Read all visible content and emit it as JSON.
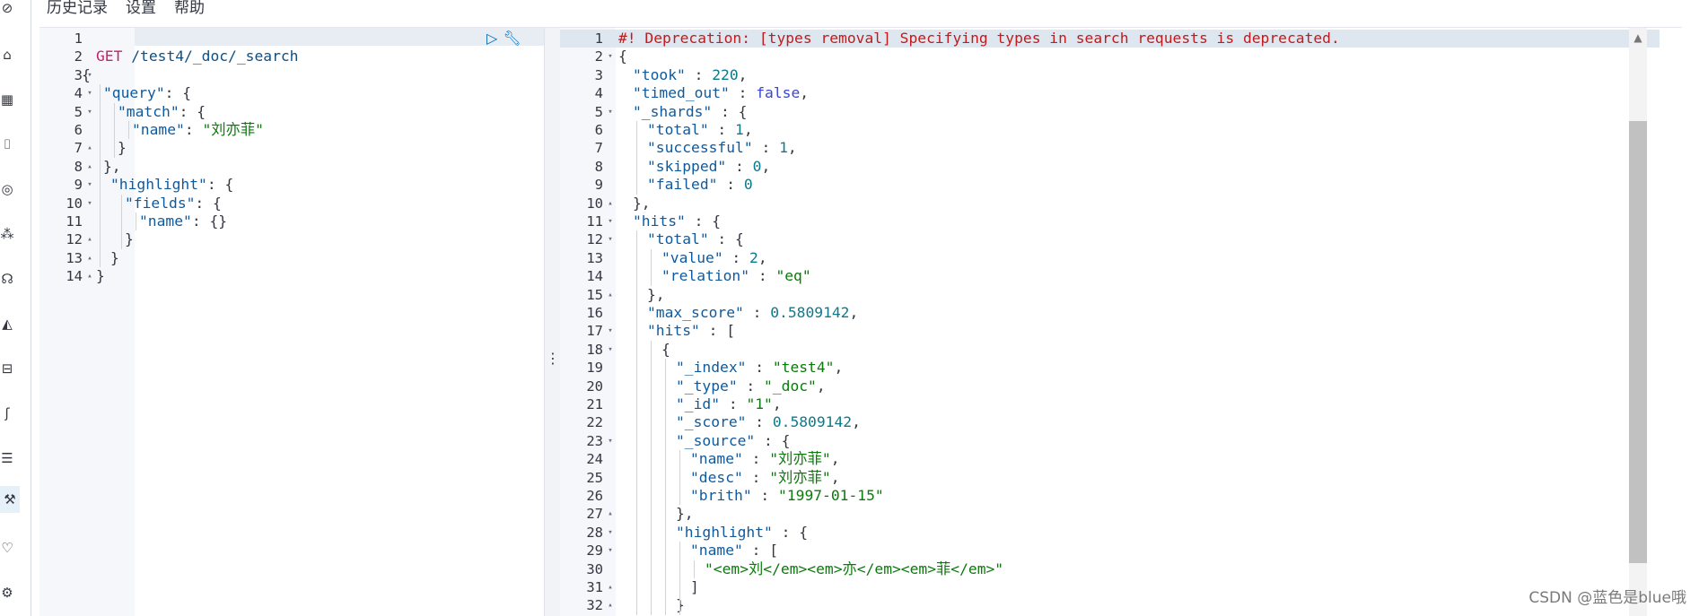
{
  "menu": {
    "items": [
      "历史记录",
      "设置",
      "帮助"
    ]
  },
  "nav_icons": [
    "compass-icon",
    "dashboard-icon",
    "discover-icon",
    "canvas-icon",
    "maps-icon",
    "ml-icon",
    "graph-icon",
    "observability-icon",
    "siem-icon",
    "apm-icon",
    "uptime-icon",
    "dev-tools-icon",
    "stack-monitoring-icon",
    "stack-management-icon"
  ],
  "action_icons": {
    "run": "play-icon",
    "settings": "wrench-icon"
  },
  "request": {
    "lines": [
      {
        "n": "1",
        "fold": "",
        "text": ""
      },
      {
        "n": "2",
        "fold": "",
        "text": "GET /test4/_doc/_search"
      },
      {
        "n": "3",
        "fold": "▾",
        "text": "{"
      },
      {
        "n": "4",
        "fold": "▾",
        "text": "\"query\": {"
      },
      {
        "n": "5",
        "fold": "▾",
        "text": "\"match\": {"
      },
      {
        "n": "6",
        "fold": "",
        "text": "\"name\": \"刘亦菲\""
      },
      {
        "n": "7",
        "fold": "▴",
        "text": "}"
      },
      {
        "n": "8",
        "fold": "▴",
        "text": "},"
      },
      {
        "n": "9",
        "fold": "▾",
        "text": "\"highlight\": {"
      },
      {
        "n": "10",
        "fold": "▾",
        "text": "\"fields\": {"
      },
      {
        "n": "11",
        "fold": "",
        "text": "\"name\": {}"
      },
      {
        "n": "12",
        "fold": "▴",
        "text": "}"
      },
      {
        "n": "13",
        "fold": "▴",
        "text": "}"
      },
      {
        "n": "14",
        "fold": "▴",
        "text": "}"
      }
    ],
    "method": "GET",
    "url": "/test4/_doc/_search"
  },
  "response": {
    "lines": [
      {
        "n": "1",
        "fold": "",
        "text": "#! Deprecation: [types removal] Specifying types in search requests is deprecated."
      },
      {
        "n": "2",
        "fold": "▾",
        "text": "{"
      },
      {
        "n": "3",
        "fold": "",
        "text": "\"took\" : 220,"
      },
      {
        "n": "4",
        "fold": "",
        "text": "\"timed_out\" : false,"
      },
      {
        "n": "5",
        "fold": "▾",
        "text": "\"_shards\" : {"
      },
      {
        "n": "6",
        "fold": "",
        "text": "\"total\" : 1,"
      },
      {
        "n": "7",
        "fold": "",
        "text": "\"successful\" : 1,"
      },
      {
        "n": "8",
        "fold": "",
        "text": "\"skipped\" : 0,"
      },
      {
        "n": "9",
        "fold": "",
        "text": "\"failed\" : 0"
      },
      {
        "n": "10",
        "fold": "▴",
        "text": "},"
      },
      {
        "n": "11",
        "fold": "▾",
        "text": "\"hits\" : {"
      },
      {
        "n": "12",
        "fold": "▾",
        "text": "\"total\" : {"
      },
      {
        "n": "13",
        "fold": "",
        "text": "\"value\" : 2,"
      },
      {
        "n": "14",
        "fold": "",
        "text": "\"relation\" : \"eq\""
      },
      {
        "n": "15",
        "fold": "▴",
        "text": "},"
      },
      {
        "n": "16",
        "fold": "",
        "text": "\"max_score\" : 0.5809142,"
      },
      {
        "n": "17",
        "fold": "▾",
        "text": "\"hits\" : ["
      },
      {
        "n": "18",
        "fold": "▾",
        "text": "{"
      },
      {
        "n": "19",
        "fold": "",
        "text": "\"_index\" : \"test4\","
      },
      {
        "n": "20",
        "fold": "",
        "text": "\"_type\" : \"_doc\","
      },
      {
        "n": "21",
        "fold": "",
        "text": "\"_id\" : \"1\","
      },
      {
        "n": "22",
        "fold": "",
        "text": "\"_score\" : 0.5809142,"
      },
      {
        "n": "23",
        "fold": "▾",
        "text": "\"_source\" : {"
      },
      {
        "n": "24",
        "fold": "",
        "text": "\"name\" : \"刘亦菲\","
      },
      {
        "n": "25",
        "fold": "",
        "text": "\"desc\" : \"刘亦菲\","
      },
      {
        "n": "26",
        "fold": "",
        "text": "\"brith\" : \"1997-01-15\""
      },
      {
        "n": "27",
        "fold": "▴",
        "text": "},"
      },
      {
        "n": "28",
        "fold": "▾",
        "text": "\"highlight\" : {"
      },
      {
        "n": "29",
        "fold": "▾",
        "text": "\"name\" : ["
      },
      {
        "n": "30",
        "fold": "",
        "text": "\"<em>刘</em><em>亦</em><em>菲</em>\""
      },
      {
        "n": "31",
        "fold": "▴",
        "text": "]"
      },
      {
        "n": "32",
        "fold": "▴",
        "text": "}"
      }
    ]
  },
  "splitter_label": "⋮",
  "watermark": "CSDN @蓝色是blue哦",
  "colors": {
    "key": "#0f5a9e",
    "string": "#0b7a0b",
    "number": "#0d7a8a",
    "bool": "#3a45d1",
    "method": "#c4226f",
    "warning": "#c11b1b"
  }
}
